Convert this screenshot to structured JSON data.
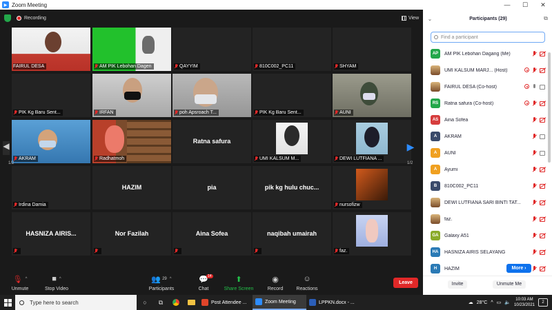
{
  "window": {
    "title": "Zoom Meeting",
    "minimize": "—",
    "maximize": "☐",
    "close": "✕"
  },
  "topbar": {
    "recording": "Recording",
    "view": "View"
  },
  "grid": {
    "tiles": [
      {
        "name": "FAIRUL DESA",
        "center": "",
        "muted": false,
        "active": true
      },
      {
        "name": "AM PIK Lebohan Dagen",
        "center": "",
        "muted": true,
        "active": false
      },
      {
        "name": "QAYYIM",
        "center": "",
        "muted": true,
        "active": false
      },
      {
        "name": "810C002_PC11",
        "center": "",
        "muted": true,
        "active": false
      },
      {
        "name": "SHYAM",
        "center": "",
        "muted": true,
        "active": false
      },
      {
        "name": "PIK Kg Baru Sent...",
        "center": "",
        "muted": true,
        "active": false
      },
      {
        "name": "IRFAN",
        "center": "",
        "muted": true,
        "active": false
      },
      {
        "name": "poh Apsroach T...",
        "center": "",
        "muted": true,
        "active": false
      },
      {
        "name": "PIK Kg Baru Sent...",
        "center": "",
        "muted": true,
        "active": false
      },
      {
        "name": "AUNI",
        "center": "",
        "muted": true,
        "active": false
      },
      {
        "name": "AKRAM",
        "center": "",
        "muted": true,
        "active": false
      },
      {
        "name": "Radhatmoh",
        "center": "",
        "muted": true,
        "active": false
      },
      {
        "name": "",
        "center": "Ratna safura",
        "muted": false,
        "active": false
      },
      {
        "name": "UMI KALSUM M...",
        "center": "",
        "muted": true,
        "active": false
      },
      {
        "name": "DEWI LUTFIANA ...",
        "center": "",
        "muted": true,
        "active": false
      },
      {
        "name": "Irdina Damia",
        "center": "",
        "muted": true,
        "active": false
      },
      {
        "name": "",
        "center": "HAZIM",
        "muted": false,
        "active": false
      },
      {
        "name": "",
        "center": "pia",
        "muted": false,
        "active": false
      },
      {
        "name": "",
        "center": "pik kg hulu chuc...",
        "muted": false,
        "active": false
      },
      {
        "name": "nursofizw",
        "center": "",
        "muted": true,
        "active": false
      },
      {
        "name": "",
        "center": "HASNIZA AIRIS...",
        "muted": true,
        "active": false
      },
      {
        "name": "",
        "center": "Nor Fazilah",
        "muted": true,
        "active": false
      },
      {
        "name": "",
        "center": "Aina Sofea",
        "muted": true,
        "active": false
      },
      {
        "name": "",
        "center": "naqibah umairah",
        "muted": true,
        "active": false
      },
      {
        "name": "faz.",
        "center": "",
        "muted": true,
        "active": false
      }
    ],
    "page_left": "1/2",
    "page_right": "1/2"
  },
  "toolbar": {
    "unmute": "Unmute",
    "stop_video": "Stop Video",
    "participants": "Participants",
    "participants_count": "29",
    "chat": "Chat",
    "chat_badge": "14",
    "share_screen": "Share Screen",
    "record": "Record",
    "reactions": "Reactions",
    "leave": "Leave"
  },
  "panel": {
    "title": "Participants (29)",
    "search_placeholder": "Find a participant",
    "items": [
      {
        "initials": "AP",
        "color": "#23a74a",
        "name": "AM PIK Lebohan Dagang (Me)",
        "photo": false,
        "rec": false,
        "mic": "off",
        "cam": "off"
      },
      {
        "initials": "",
        "color": "#b88a4a",
        "name": "UMI KALSUM MARJ...   (Host)",
        "photo": true,
        "rec": true,
        "mic": "off",
        "cam": "off"
      },
      {
        "initials": "",
        "color": "#6a86b5",
        "name": "FAIRUL DESA (Co-host)",
        "photo": true,
        "rec": true,
        "mic": "on",
        "cam": "on"
      },
      {
        "initials": "RS",
        "color": "#23a74a",
        "name": "Ratna safura (Co-host)",
        "photo": false,
        "rec": true,
        "mic": "off",
        "cam": "off"
      },
      {
        "initials": "AS",
        "color": "#d63d3d",
        "name": "Aina Sofea",
        "photo": false,
        "rec": false,
        "mic": "off",
        "cam": "off"
      },
      {
        "initials": "A",
        "color": "#3a4a6a",
        "name": "AKRAM",
        "photo": false,
        "rec": false,
        "mic": "off",
        "cam": "on"
      },
      {
        "initials": "A",
        "color": "#f0a020",
        "name": "AUNI",
        "photo": false,
        "rec": false,
        "mic": "off",
        "cam": "on"
      },
      {
        "initials": "A",
        "color": "#f0a020",
        "name": "Ayumi",
        "photo": false,
        "rec": false,
        "mic": "off",
        "cam": "off"
      },
      {
        "initials": "B",
        "color": "#3a4a6a",
        "name": "810C002_PC11",
        "photo": false,
        "rec": false,
        "mic": "off",
        "cam": "off"
      },
      {
        "initials": "",
        "color": "#a07050",
        "name": "DEWI LUTFIANA SARI BINTI TAT...",
        "photo": true,
        "rec": false,
        "mic": "off",
        "cam": "off"
      },
      {
        "initials": "",
        "color": "#8a9ac8",
        "name": "faz.",
        "photo": true,
        "rec": false,
        "mic": "off",
        "cam": "off"
      },
      {
        "initials": "GA",
        "color": "#8aab2a",
        "name": "Galaxy A51",
        "photo": false,
        "rec": false,
        "mic": "off",
        "cam": "off"
      },
      {
        "initials": "HA",
        "color": "#2a7ab5",
        "name": "HASNIZA AIRIS SELAYANG",
        "photo": false,
        "rec": false,
        "mic": "off",
        "cam": "off"
      },
      {
        "initials": "H",
        "color": "#2a7ab5",
        "name": "HAZIM",
        "photo": false,
        "rec": false,
        "mic": "off",
        "cam": "off"
      }
    ],
    "more": "More ›",
    "invite": "Invite",
    "unmute_me": "Unmute Me"
  },
  "taskbar": {
    "search": "Type here to search",
    "apps": [
      {
        "label": "Post Attendee ...",
        "color": "#e0452a",
        "active": false
      },
      {
        "label": "Zoom Meeting",
        "color": "#2d8cff",
        "active": true
      },
      {
        "label": "LPPKN.docx - ...",
        "color": "#2b5eb8",
        "active": false
      }
    ],
    "temp": "28°C",
    "time": "10:03 AM",
    "date": "10/23/2021",
    "notifications": "2"
  }
}
